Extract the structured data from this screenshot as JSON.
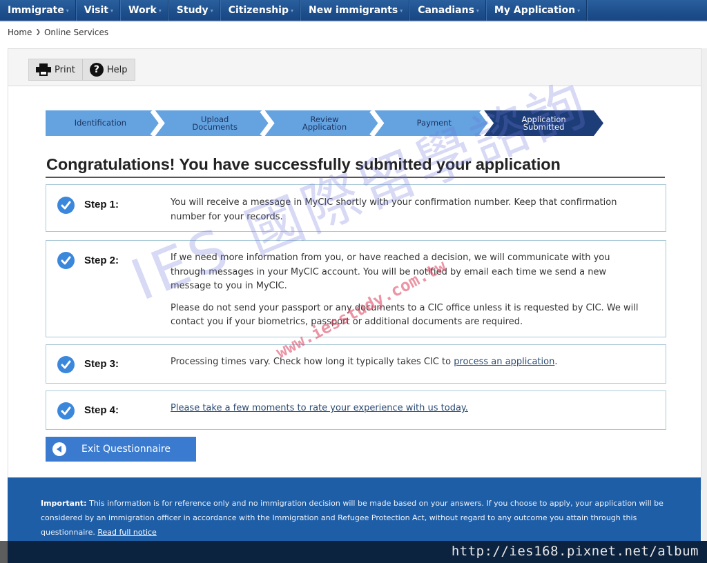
{
  "nav": {
    "items": [
      {
        "label": "Immigrate"
      },
      {
        "label": "Visit"
      },
      {
        "label": "Work"
      },
      {
        "label": "Study"
      },
      {
        "label": "Citizenship"
      },
      {
        "label": "New immigrants"
      },
      {
        "label": "Canadians"
      },
      {
        "label": "My Application"
      }
    ],
    "caret": "▾"
  },
  "breadcrumb": {
    "items": [
      "Home",
      "Online Services"
    ],
    "separator": "❯"
  },
  "toolbar": {
    "print_label": "Print",
    "help_label": "Help",
    "help_glyph": "?"
  },
  "stepper": {
    "steps": [
      {
        "line1": "Identification",
        "line2": "",
        "state": "done"
      },
      {
        "line1": "Upload",
        "line2": "Documents",
        "state": "done"
      },
      {
        "line1": "Review",
        "line2": "Application",
        "state": "done"
      },
      {
        "line1": "Payment",
        "line2": "",
        "state": "done"
      },
      {
        "line1": "Application",
        "line2": "Submitted",
        "state": "active"
      }
    ],
    "colors": {
      "done": "#64a2e0",
      "active": "#1d3d78",
      "separator": "#ffffff"
    }
  },
  "page": {
    "title": "Congratulations! You have successfully submitted your application"
  },
  "steps": [
    {
      "name": "Step 1:",
      "paragraphs": [
        "You will receive a message in MyCIC shortly with your confirmation number. Keep that confirmation number for your records."
      ]
    },
    {
      "name": "Step 2:",
      "paragraphs": [
        "If we need more information from you, or have reached a decision, we will communicate with you through messages in your MyCIC account. You will be notified by email each time we send a new message to you in MyCIC.",
        "Please do not send your passport or any documents to a CIC office unless it is requested by CIC. We will contact you if your biometrics, passport or additional documents are required."
      ]
    },
    {
      "name": "Step 3:",
      "text_before": "Processing times vary. Check how long it typically takes CIC to ",
      "link": "process an application",
      "text_after": "."
    },
    {
      "name": "Step 4:",
      "link": "Please take a few moments to rate your experience with us today."
    }
  ],
  "exit_button": {
    "label": "Exit Questionnaire"
  },
  "notice": {
    "bold": "Important:",
    "text": " This information is for reference only and no immigration decision will be made based on your answers. If you choose to apply, your application will be considered by an immigration officer in accordance with the Immigration and Refugee Protection Act, without regard to any outcome you attain through this questionnaire. ",
    "link": "Read full notice"
  },
  "watermark": {
    "primary": "IES 國際留學諮詢",
    "secondary": "www.iesstudy.com.tw",
    "url_overlay": "http://ies168.pixnet.net/album"
  }
}
